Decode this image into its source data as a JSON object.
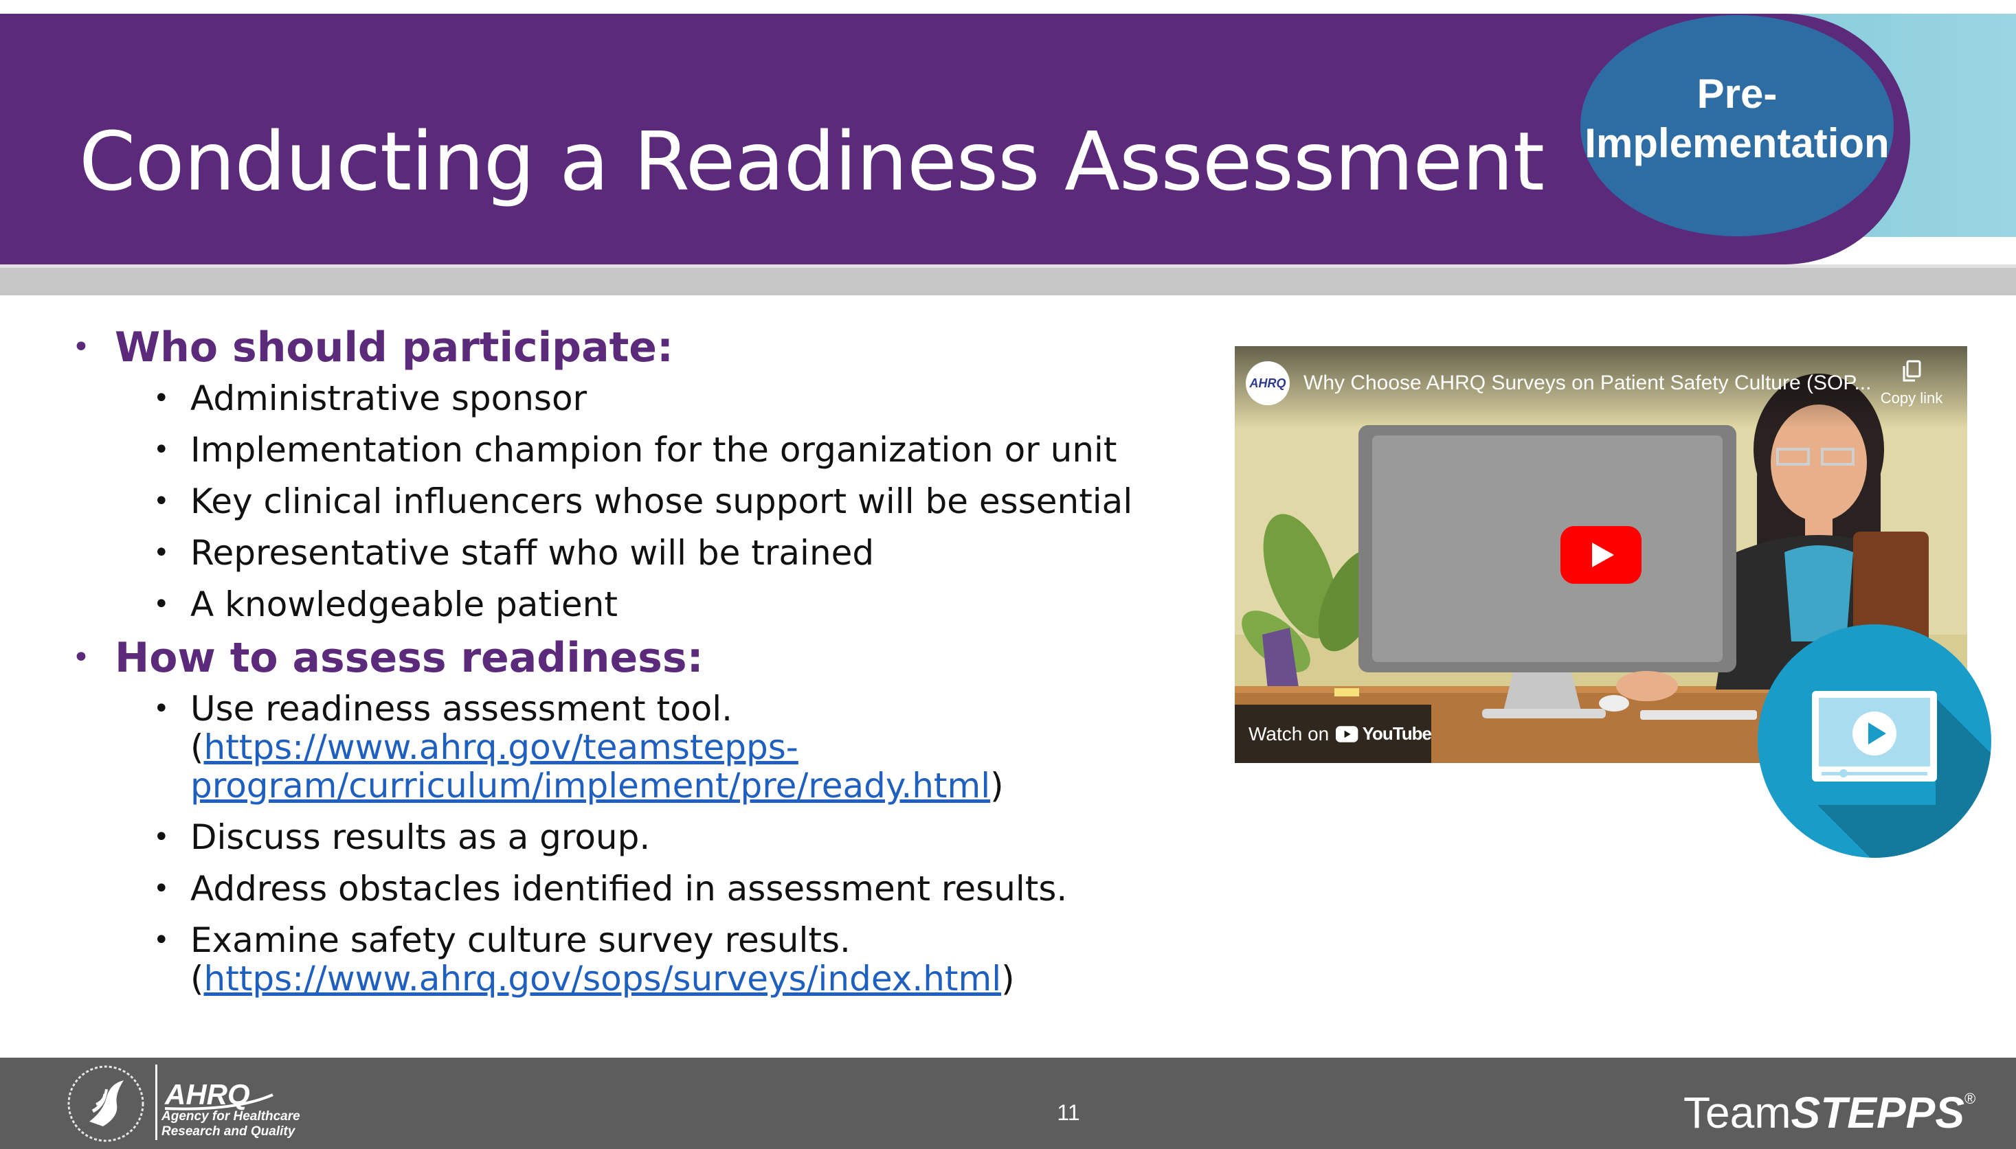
{
  "slide": {
    "title": "Conducting a Readiness Assessment",
    "phase_badge": "Pre-Implementation",
    "page_number": "11"
  },
  "sections": [
    {
      "heading": "Who should participate:",
      "items": [
        {
          "text": "Administrative sponsor"
        },
        {
          "text": "Implementation champion for the organization or unit"
        },
        {
          "text": "Key clinical influencers whose support will be essential"
        },
        {
          "text": "Representative staff who will be trained"
        },
        {
          "text": "A knowledgeable patient"
        }
      ]
    },
    {
      "heading": "How to assess readiness:",
      "items": [
        {
          "text": "Use readiness assessment tool.",
          "link_open": "(",
          "link": "https://www.ahrq.gov/teamstepps-program/curriculum/implement/pre/ready.html",
          "link_line1": "https://www.ahrq.gov/teamstepps-",
          "link_line2": "program/curriculum/implement/pre/ready.html",
          "link_close": ")"
        },
        {
          "text": "Discuss results as a group."
        },
        {
          "text": "Address obstacles identified in assessment results."
        },
        {
          "text": "Examine safety culture survey results.",
          "link_open": "(",
          "link": "https://www.ahrq.gov/sops/surveys/index.html",
          "link_close": ")"
        }
      ]
    }
  ],
  "video": {
    "title": "Why Choose AHRQ Surveys on Patient Safety Culture (SOP...",
    "channel_logo_text": "AHRQ",
    "copy_link_label": "Copy link",
    "watch_on_label": "Watch on",
    "youtube_label": "YouTube"
  },
  "footer": {
    "agency_logo_text": "AHRQ",
    "agency_tagline_line1": "Agency for Healthcare",
    "agency_tagline_line2": "Research and Quality",
    "brand_first": "Team",
    "brand_second": "STEPPS",
    "brand_mark": "®"
  },
  "colors": {
    "header_purple": "#5b2a7a",
    "badge_blue": "#2e6da4",
    "accent_teal": "#7ac7d8",
    "link_blue": "#1f5fbf",
    "footer_gray": "#5d5d5d",
    "youtube_red": "#ff0000",
    "video_icon_blue": "#1a9cc9"
  }
}
